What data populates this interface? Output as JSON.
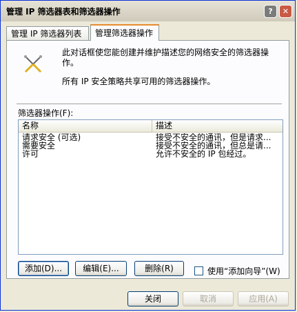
{
  "window": {
    "title": "管理 IP 筛选器表和筛选器操作",
    "help_label": "?",
    "close_label": "✕"
  },
  "tabs": [
    {
      "label": "管理 IP 筛选器列表"
    },
    {
      "label": "管理筛选器操作"
    }
  ],
  "panel": {
    "description": "此对话框使您能创建并维护描述您的网络安全的筛选器操作。",
    "note": "所有 IP 安全策略共享可用的筛选器操作。",
    "list_label": "筛选器操作(F):",
    "columns": [
      "名称",
      "描述"
    ],
    "rows": [
      {
        "name": "请求安全 (可选)",
        "desc": "接受不安全的通讯，但是请求..."
      },
      {
        "name": "需要安全",
        "desc": "接受不安全的通讯，但总是请..."
      },
      {
        "name": "许可",
        "desc": "允许不安全的 IP 包经过。"
      }
    ],
    "add_label": "添加(D)...",
    "edit_label": "编辑(E)...",
    "remove_label": "删除(R)",
    "wizard_label": "使用“添加向导”(W)"
  },
  "footer": {
    "close_label": "关闭",
    "cancel_label": "取消",
    "apply_label": "应用(A)"
  },
  "icons": {
    "tools": "crossed-tools-icon"
  }
}
